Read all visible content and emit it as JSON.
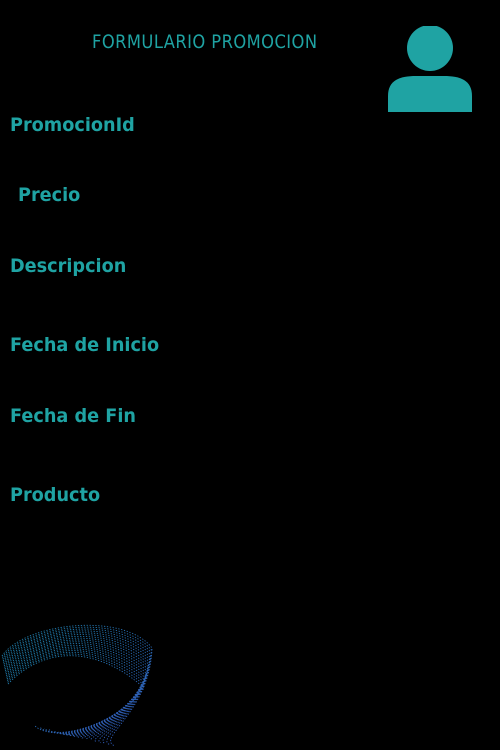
{
  "form": {
    "title": "FORMULARIO PROMOCION",
    "fields": {
      "promocion_id": "PromocionId",
      "precio": "Precio",
      "descripcion": "Descripcion",
      "fecha_inicio": "Fecha de Inicio",
      "fecha_fin": "Fecha de Fin",
      "producto": "Producto"
    }
  },
  "icons": {
    "header": "user-avatar-icon",
    "decoration": "wave-pattern"
  },
  "colors": {
    "background": "#000000",
    "accent": "#1fa3a3",
    "wave_primary": "#1f8fb8",
    "wave_secondary": "#3a5fcf"
  }
}
